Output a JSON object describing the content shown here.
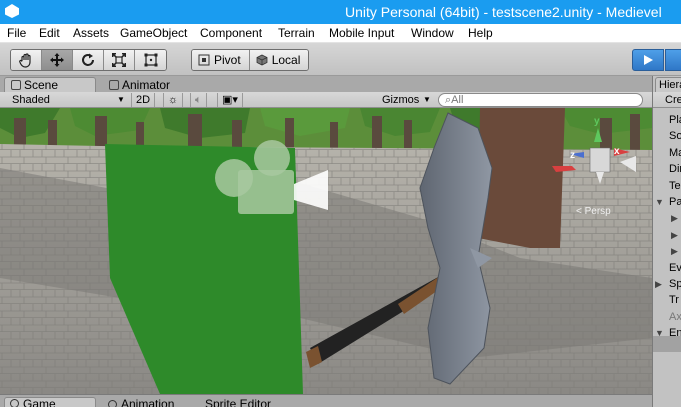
{
  "window": {
    "title": "Unity Personal (64bit) - testscene2.unity - Medievel"
  },
  "menu": [
    "File",
    "Edit",
    "Assets",
    "GameObject",
    "Component",
    "Terrain",
    "Mobile Input",
    "Window",
    "Help"
  ],
  "toolbar": {
    "tools": [
      "hand-icon",
      "move-icon",
      "rotate-icon",
      "scale-icon",
      "rect-transform-icon"
    ],
    "active_tool_index": 1,
    "pivot_label": "Pivot",
    "local_label": "Local"
  },
  "scene_tabs": {
    "scene": "Scene",
    "animator": "Animator"
  },
  "scene_bar": {
    "shading": "Shaded",
    "mode_2d": "2D",
    "gizmos": "Gizmos",
    "search_placeholder": "All"
  },
  "gizmo": {
    "x": "x",
    "y": "y",
    "z": "z",
    "projection": "Persp"
  },
  "hierarchy": {
    "tab": "Hierarchy",
    "create": "Create",
    "rows": [
      {
        "label": "Pla",
        "arrow": ""
      },
      {
        "label": "So",
        "arrow": ""
      },
      {
        "label": "Ma",
        "arrow": ""
      },
      {
        "label": "Dir",
        "arrow": ""
      },
      {
        "label": "Te",
        "arrow": ""
      },
      {
        "label": "Pa",
        "arrow": "down"
      },
      {
        "label": "",
        "arrow": "right"
      },
      {
        "label": "",
        "arrow": "right"
      },
      {
        "label": "",
        "arrow": "right"
      },
      {
        "label": "Ev",
        "arrow": ""
      },
      {
        "label": "Sp",
        "arrow": "right"
      },
      {
        "label": "Tr",
        "arrow": ""
      },
      {
        "label": "Ax",
        "arrow": "",
        "dim": true
      },
      {
        "label": "En",
        "arrow": "down"
      }
    ]
  },
  "bottom_tabs": {
    "game": "Game",
    "animation": "Animation",
    "sprite_editor": "Sprite Editor"
  },
  "colors": {
    "titlebar": "#1a9cf0",
    "play_button": "#3b86d9",
    "green_shield": "#2e8a2a",
    "ground": "#8e8e8e",
    "sky": "#78a8d0"
  }
}
